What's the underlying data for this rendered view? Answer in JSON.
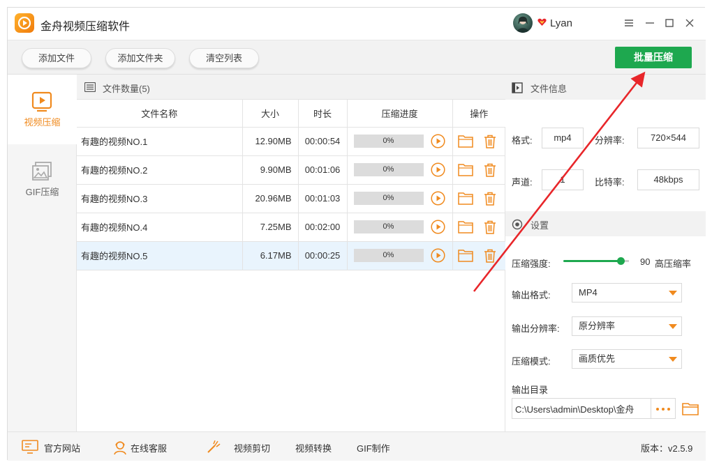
{
  "app": {
    "title": "金舟视频压缩软件",
    "username": "Lyan"
  },
  "toolbar": {
    "add_file": "添加文件",
    "add_folder": "添加文件夹",
    "clear_list": "清空列表",
    "batch_compress": "批量压缩"
  },
  "sidebar": {
    "items": [
      {
        "label": "视频压缩",
        "icon": "video-compress-icon"
      },
      {
        "label": "GIF压缩",
        "icon": "gif-compress-icon"
      }
    ]
  },
  "file_list": {
    "header": "文件数量(5)",
    "columns": [
      "文件名称",
      "大小",
      "时长",
      "压缩进度",
      "操作"
    ],
    "rows": [
      {
        "name": "有趣的视频NO.1",
        "size": "12.90MB",
        "duration": "00:00:54",
        "progress": "0%"
      },
      {
        "name": "有趣的视频NO.2",
        "size": "9.90MB",
        "duration": "00:01:06",
        "progress": "0%"
      },
      {
        "name": "有趣的视频NO.3",
        "size": "20.96MB",
        "duration": "00:01:03",
        "progress": "0%"
      },
      {
        "name": "有趣的视频NO.4",
        "size": "7.25MB",
        "duration": "00:02:00",
        "progress": "0%"
      },
      {
        "name": "有趣的视频NO.5",
        "size": "6.17MB",
        "duration": "00:00:25",
        "progress": "0%"
      }
    ]
  },
  "file_info": {
    "title": "文件信息",
    "format_label": "格式:",
    "format_value": "mp4",
    "resolution_label": "分辨率:",
    "resolution_value": "720×544",
    "channel_label": "声道:",
    "channel_value": "1",
    "bitrate_label": "比特率:",
    "bitrate_value": "48kbps"
  },
  "settings": {
    "title": "设置",
    "strength_label": "压缩强度:",
    "strength_value": "90",
    "strength_level": 0.9,
    "strength_desc": "高压缩率",
    "output_format_label": "输出格式:",
    "output_format_value": "MP4",
    "output_resolution_label": "输出分辨率:",
    "output_resolution_value": "原分辨率",
    "compress_mode_label": "压缩模式:",
    "compress_mode_value": "画质优先",
    "output_dir_label": "输出目录",
    "output_dir_value": "C:\\Users\\admin\\Desktop\\金舟"
  },
  "footer": {
    "website": "官方网站",
    "support": "在线客服",
    "video_cut": "视频剪切",
    "video_convert": "视频转换",
    "gif_make": "GIF制作",
    "version": "版本：v2.5.9"
  },
  "colors": {
    "accent": "#f08a1e",
    "primary_green": "#1ea84f",
    "annotation_red": "#e8262a"
  }
}
